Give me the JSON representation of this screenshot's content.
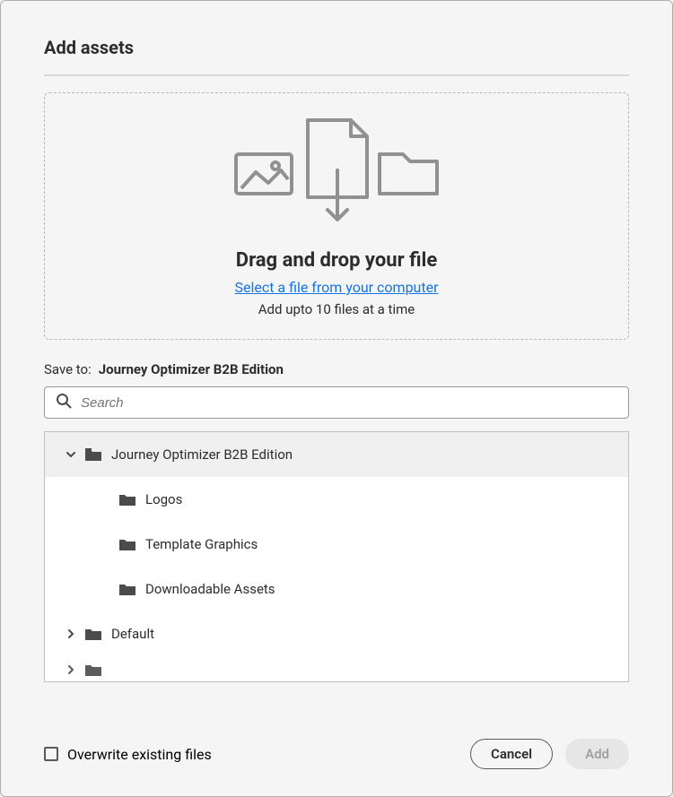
{
  "dialog": {
    "title": "Add assets"
  },
  "dropzone": {
    "heading": "Drag and drop your file",
    "link": "Select a file from your computer",
    "note": "Add upto 10 files at a time"
  },
  "save": {
    "label": "Save to:",
    "value": "Journey Optimizer B2B Edition"
  },
  "search": {
    "placeholder": "Search"
  },
  "tree": {
    "root1": {
      "label": "Journey Optimizer B2B Edition",
      "expanded": true,
      "children": [
        {
          "label": "Logos"
        },
        {
          "label": "Template Graphics"
        },
        {
          "label": "Downloadable Assets"
        }
      ]
    },
    "root2": {
      "label": "Default",
      "expanded": false
    }
  },
  "footer": {
    "overwrite_label": "Overwrite existing files",
    "cancel": "Cancel",
    "add": "Add"
  }
}
